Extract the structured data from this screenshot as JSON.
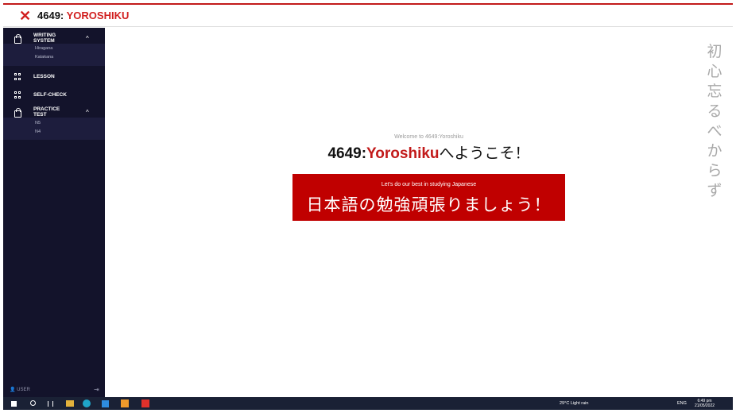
{
  "header": {
    "brand_num": "4649:",
    "brand_name": "YOROSHIKU"
  },
  "sidebar": {
    "writing_system": {
      "label_line1": "WRITING",
      "label_line2": "SYSTEM",
      "items": [
        "Hiragana",
        "Katakana"
      ]
    },
    "lesson": {
      "label": "LESSON"
    },
    "self_check": {
      "label": "SELF-CHECK"
    },
    "practice_test": {
      "label_line1": "PRACTICE",
      "label_line2": "TEST",
      "items": [
        "N5",
        "N4"
      ]
    },
    "user_label": "USER"
  },
  "main": {
    "welcome": "Welcome to 4649:Yoroshiku",
    "headline_num": "4649:",
    "headline_name": "Yoroshiku",
    "headline_suffix": "へようこそ！",
    "banner_sub": "Let's do our best in studying Japanese",
    "banner_main": "日本語の勉強頑張りましょう！",
    "vertical_chars": [
      "初",
      "心",
      "忘",
      "る",
      "べ",
      "か",
      "ら",
      "ず"
    ]
  },
  "taskbar": {
    "weather": "29°C  Light rain",
    "lang": "ENG",
    "time": "6:49 pm",
    "date": "21/05/2022"
  },
  "colors": {
    "accent": "#c21a1a",
    "sidebar_bg": "#13132b",
    "banner_bg": "#c00000",
    "taskbar_bg": "#1a2135"
  }
}
